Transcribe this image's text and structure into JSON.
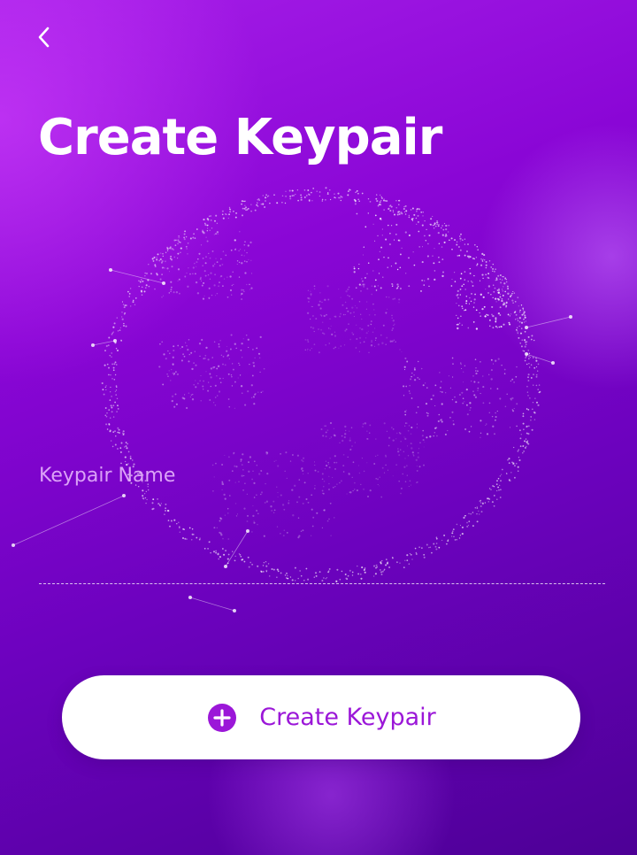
{
  "header": {
    "back_icon": "chevron-left-icon",
    "title": "Create Keypair"
  },
  "form": {
    "keypair_name_label": "Keypair Name",
    "keypair_name_value": ""
  },
  "primary_action": {
    "icon": "plus-circle-icon",
    "label": "Create Keypair"
  },
  "colors": {
    "background_start": "#a61ee8",
    "background_end": "#4d0096",
    "button_background": "#ffffff",
    "button_accent": "#9b17d8"
  }
}
